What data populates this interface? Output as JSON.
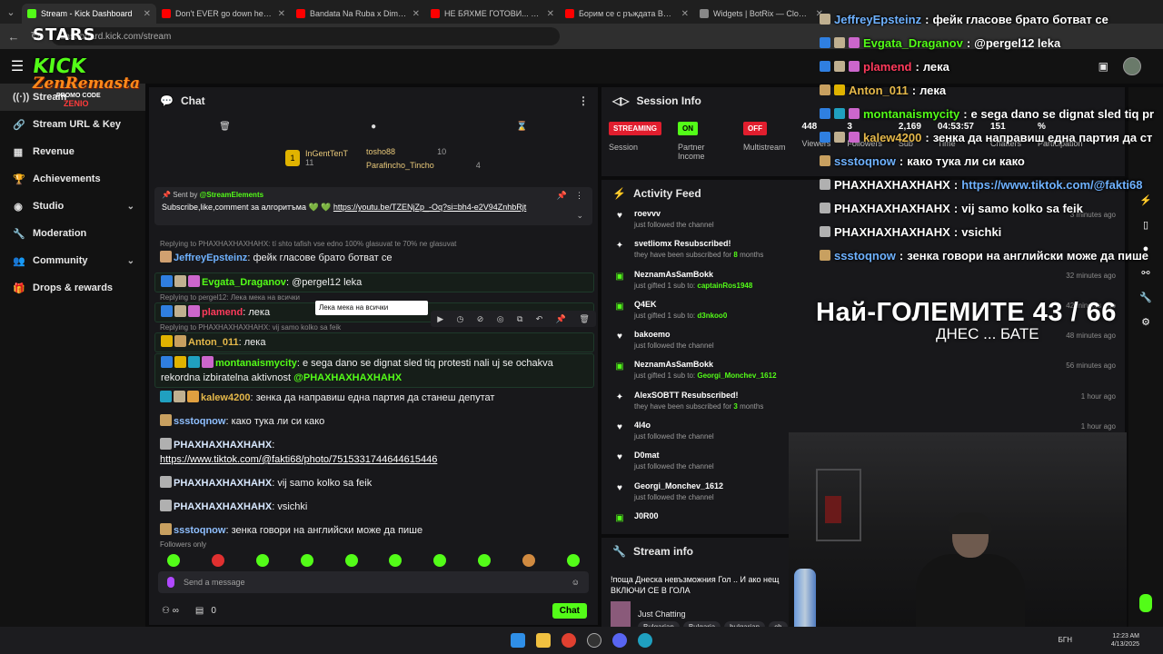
{
  "browser": {
    "tabs": [
      {
        "title": "Stream - Kick Dashboard",
        "color": "#53fc18",
        "active": true
      },
      {
        "title": "Don't EVER go down here... (Pa",
        "color": "#ff0000",
        "active": false
      },
      {
        "title": "Bandata Na Ruba x Dim4ou - J",
        "color": "#ff0000",
        "active": false
      },
      {
        "title": "НЕ БЯХМЕ ГОТОВИ... но тръгн",
        "color": "#ff0000",
        "active": false
      },
      {
        "title": "Борим се с ръждата BMW e3",
        "color": "#ff0000",
        "active": false
      },
      {
        "title": "Widgets | BotRix — Cloud Strea",
        "color": "#888888",
        "active": false
      }
    ],
    "url": "dashboard.kick.com/stream"
  },
  "overlay_logo": {
    "stars": "STARS",
    "kick": "KICK",
    "zen": "ZenRemasta",
    "promo": "PROMO CODE",
    "code": "ZENIO"
  },
  "sidebar": {
    "items": [
      {
        "label": "Stream",
        "icon": "stream-icon",
        "glyph": "((·))",
        "active": true
      },
      {
        "label": "Stream URL & Key",
        "icon": "link-icon",
        "glyph": "🔗"
      },
      {
        "label": "Revenue",
        "icon": "revenue-icon",
        "glyph": "▦"
      },
      {
        "label": "Achievements",
        "icon": "trophy-icon",
        "glyph": "🏆"
      },
      {
        "label": "Studio",
        "icon": "studio-icon",
        "glyph": "◉",
        "chevron": "⌄"
      },
      {
        "label": "Moderation",
        "icon": "wrench-icon",
        "glyph": "🔧"
      },
      {
        "label": "Community",
        "icon": "community-icon",
        "glyph": "👥",
        "chevron": "⌄"
      },
      {
        "label": "Drops & rewards",
        "icon": "gift-icon",
        "glyph": "🎁"
      }
    ]
  },
  "chat": {
    "title": "Chat",
    "leaderboard": {
      "top": {
        "name": "InGentTenT",
        "count": "11"
      },
      "col2": [
        {
          "name": "tosho88",
          "count": "10"
        },
        {
          "name": "Parafincho_Tincho",
          "count": "4"
        }
      ]
    },
    "pinned": {
      "sent_by_label": "Sent by",
      "sent_by": "@StreamElements",
      "text": "Subscribe,like,comment за алгоритъма 💚 💚 ",
      "link": "https://youtu.be/TZENjZp_-Oq?si=bh4-e2V94ZnhbRjt"
    },
    "messages": [
      {
        "reply": "Replying to PHAXHAXHAXHAHX: tí shto tafish vse edno 100% glasuvat te 70% ne glasuvat",
        "user": "JeffreyEpsteinz",
        "ucls": "u-blue",
        "text": "фейк гласове брато ботват се",
        "hl": false,
        "badges": [
          "#d0a070"
        ]
      },
      {
        "reply": "",
        "user": "Evgata_Draganov",
        "ucls": "u-green",
        "text": "@pergel12 leka",
        "hl": true,
        "badges": [
          "#2f7fe0",
          "#c0b090",
          "#cc66cc"
        ]
      },
      {
        "reply": "Replying to pergel12: Лека мека на всички",
        "user": "plamend",
        "ucls": "u-red",
        "text": "лека",
        "hl": true,
        "badges": [
          "#2f7fe0",
          "#c0b090",
          "#cc66cc"
        ]
      },
      {
        "reply": "Replying to PHAXHAXHAXHAHX: vij samo kolko sa feik",
        "user": "Anton_011",
        "ucls": "u-gold",
        "text": "лека",
        "hl": true,
        "badges": [
          "#e0b300",
          "#c8a060"
        ]
      },
      {
        "reply": "",
        "user": "montanaismycity",
        "ucls": "u-green",
        "text": "e sega dano se dignat sled tiq protesti nali uj se ochakva rekordna izbiratelna aktivnost",
        "mention": "@PHAXHAXHAXHAHX",
        "hl": true,
        "badges": [
          "#2f7fe0",
          "#e0b300",
          "#20a0c0",
          "#cc66cc"
        ]
      },
      {
        "reply": "",
        "user": "kalew4200",
        "ucls": "u-gold",
        "text": "зенка да направиш една партия да станеш депутат",
        "hl": false,
        "badges": [
          "#20a0c0",
          "#c0b090",
          "#e0a040"
        ]
      },
      {
        "reply": "",
        "user": "ssstoqnow",
        "ucls": "u-lblue",
        "text": "како тука ли си како",
        "hl": false,
        "badges": [
          "#c8a060"
        ]
      },
      {
        "reply": "",
        "user": "PHAXHAXHAXHAHX",
        "ucls": "u-white",
        "text": "",
        "link": "https://www.tiktok.com/@fakti68/photo/7515331744644615446",
        "hl": false,
        "badges": [
          "#b0b0b0"
        ]
      },
      {
        "reply": "",
        "user": "PHAXHAXHAXHAHX",
        "ucls": "u-white",
        "text": "vij samo kolko sa feik",
        "hl": false,
        "badges": [
          "#b0b0b0"
        ]
      },
      {
        "reply": "",
        "user": "PHAXHAXHAXHAHX",
        "ucls": "u-white",
        "text": "vsichki",
        "hl": false,
        "badges": [
          "#b0b0b0"
        ]
      },
      {
        "reply": "",
        "user": "ssstoqnow",
        "ucls": "u-lblue",
        "text": "зенка говори на английски може да пише",
        "hl": false,
        "badges": [
          "#c8a060"
        ]
      }
    ],
    "tooltip": "Лека мека на всички",
    "followers_only": "Followers only",
    "input_placeholder": "Send a message",
    "foot_count": "0",
    "chat_button": "Chat"
  },
  "session": {
    "title": "Session Info",
    "stats": [
      {
        "pill": "STREAMING",
        "pill_color": "red",
        "label": "Session"
      },
      {
        "pill": "ON",
        "pill_color": "green",
        "label": "Partner Income"
      },
      {
        "pill": "OFF",
        "pill_color": "red",
        "label": "Multistream"
      },
      {
        "value": "448",
        "label": "Viewers"
      },
      {
        "value": "3",
        "label": "Followers"
      },
      {
        "value": "2,169",
        "label": "Sub"
      },
      {
        "value": "04:53:57",
        "label": "Time"
      },
      {
        "value": "151",
        "label": "Chatters"
      },
      {
        "value": "%",
        "label": "Participation"
      }
    ]
  },
  "activity": {
    "title": "Activity Feed",
    "items": [
      {
        "icon": "heart-icon",
        "glyph": "♥",
        "name": "roevvv",
        "sub": "just followed the channel",
        "time": "3 minutes ago"
      },
      {
        "icon": "star-icon",
        "glyph": "✦",
        "name": "svetliomx Resubscribed!",
        "sub": "they have been subscribed for ",
        "bold": "8",
        "sub2": " months",
        "time": ""
      },
      {
        "icon": "gift-icon",
        "glyph": "▣",
        "name": "NeznamAsSamBokk",
        "sub": "just gifted 1 sub to: ",
        "bold": "captainRos1948",
        "time": "32 minutes ago"
      },
      {
        "icon": "gift-icon",
        "glyph": "▣",
        "name": "Q4EK",
        "sub": "just gifted 1 sub to: ",
        "bold": "d3nkoo0",
        "time": "42 minutes ago"
      },
      {
        "icon": "heart-icon",
        "glyph": "♥",
        "name": "bakoemo",
        "sub": "just followed the channel",
        "time": "48 minutes ago"
      },
      {
        "icon": "gift-icon",
        "glyph": "▣",
        "name": "NeznamAsSamBokk",
        "sub": "just gifted 1 sub to: ",
        "bold": "Georgi_Monchev_1612",
        "time": "56 minutes ago"
      },
      {
        "icon": "star-icon",
        "glyph": "✦",
        "name": "AlexSOBTT Resubscribed!",
        "sub": "they have been subscribed for ",
        "bold": "3",
        "sub2": " months",
        "time": "1 hour ago"
      },
      {
        "icon": "heart-icon",
        "glyph": "♥",
        "name": "4l4o",
        "sub": "just followed the channel",
        "time": "1 hour ago"
      },
      {
        "icon": "heart-icon",
        "glyph": "♥",
        "name": "D0mat",
        "sub": "just followed the channel",
        "time": ""
      },
      {
        "icon": "heart-icon",
        "glyph": "♥",
        "name": "Georgi_Monchev_1612",
        "sub": "just followed the channel",
        "time": ""
      },
      {
        "icon": "gift-icon",
        "glyph": "▣",
        "name": "J0R00",
        "sub": "",
        "time": ""
      }
    ]
  },
  "stream_info": {
    "title": "Stream info",
    "stream_title": "!поща Днеска невъзможния Гол .. И ако нещ ВКЛЮЧИ СЕ В ГОЛА",
    "category": "Just Chatting",
    "tags": [
      "Bulgarian",
      "Bulgaria",
      "bulgarian",
      "ch"
    ]
  },
  "overlay_chat": [
    {
      "user": "JeffreyEpsteinz",
      "color": "#6fb2ff",
      "text": "фейк гласове брато ботват се",
      "badges": [
        "#c0b090"
      ]
    },
    {
      "user": "Evgata_Draganov",
      "color": "#53fc18",
      "text": "@pergel12 leka",
      "badges": [
        "#2f7fe0",
        "#c0b090",
        "#cc66cc"
      ]
    },
    {
      "user": "plamend",
      "color": "#ff3b5c",
      "text": "лека",
      "badges": [
        "#2f7fe0",
        "#c0b090",
        "#cc66cc"
      ]
    },
    {
      "user": "Anton_011",
      "color": "#e5b84a",
      "text": "лека",
      "badges": [
        "#c8a060",
        "#e0b300"
      ]
    },
    {
      "user": "montanaismycity",
      "color": "#53fc18",
      "text": "e sega dano se dignat sled tiq pr",
      "badges": [
        "#2f7fe0",
        "#20a0c0",
        "#cc66cc"
      ]
    },
    {
      "user": "kalew4200",
      "color": "#e5b84a",
      "text": "зенка да направиш една партия да ст",
      "badges": [
        "#2f7fe0",
        "#c0b090",
        "#cc66cc"
      ]
    },
    {
      "user": "ssstoqnow",
      "color": "#6fb2ff",
      "text": "како тука ли си како",
      "badges": [
        "#c8a060"
      ]
    },
    {
      "user": "PHAXHAXHAXHAHX",
      "color": "#ffffff",
      "text": "https://www.tiktok.com/@fakti68",
      "badges": [
        "#b0b0b0"
      ]
    },
    {
      "user": "PHAXHAXHAXHAHX",
      "color": "#ffffff",
      "text": "vij samo kolko sa feik",
      "badges": [
        "#b0b0b0"
      ]
    },
    {
      "user": "PHAXHAXHAXHAHX",
      "color": "#ffffff",
      "text": "vsichki",
      "badges": [
        "#b0b0b0"
      ]
    },
    {
      "user": "ssstoqnow",
      "color": "#6fb2ff",
      "text": "зенка говори на английски може да пише",
      "badges": [
        "#c8a060"
      ]
    }
  ],
  "goal": {
    "title": "Най-ГОЛЕМИТЕ 43 / 66",
    "subtitle": "ДНЕС ... БАТЕ"
  },
  "taskbar": {
    "lang": "БГН",
    "time": "12:23 AM",
    "date": "4/13/2025"
  }
}
